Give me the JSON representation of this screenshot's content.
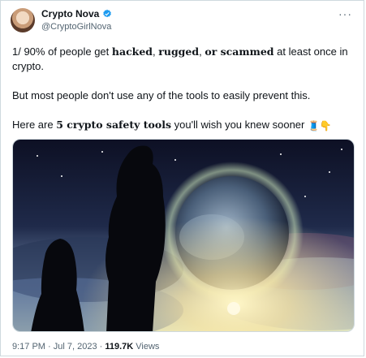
{
  "author": {
    "name": "Crypto Nova",
    "handle": "@CryptoGirlNova"
  },
  "more_icon": "more-horizontal-icon",
  "text": {
    "p1_pre": "1/ 90% of people get ",
    "p1_hacked": "hacked",
    "p1_comma1": ", ",
    "p1_rugged": "rugged",
    "p1_comma2": ", ",
    "p1_or": "or scammed",
    "p1_post": " at least once in crypto.",
    "p2": "But most people don't use any of the tools to easily prevent this.",
    "p3_pre": "Here are ",
    "p3_bold": "5 crypto safety tools",
    "p3_post": " you'll wish you knew sooner "
  },
  "emojis": [
    "thread-icon",
    "pointing-down-hand-icon"
  ],
  "media_alt": "anime-silhouettes-and-planet-artwork",
  "meta": {
    "time": "9:17 PM",
    "sep1": " · ",
    "date": "Jul 7, 2023",
    "sep2": " · ",
    "views_count": "119.7K",
    "views_label": " Views"
  }
}
